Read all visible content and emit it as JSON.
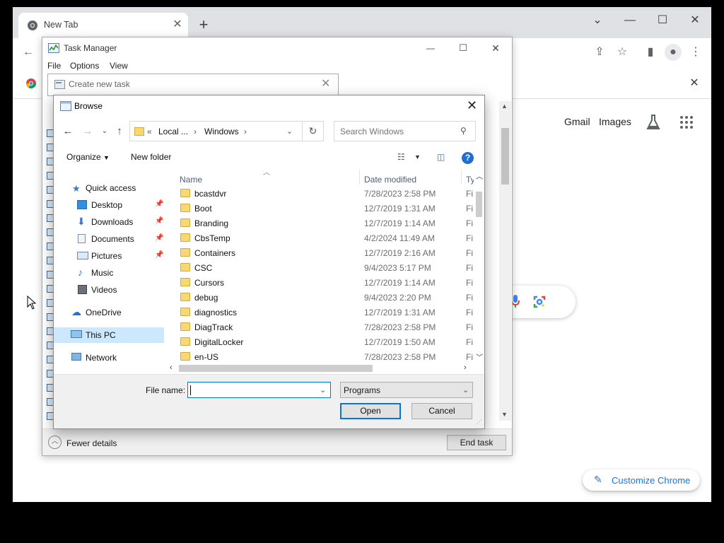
{
  "chrome": {
    "tab_title": "New Tab",
    "new_tab": "+",
    "ntp_links": [
      "Gmail",
      "Images"
    ],
    "customize_label": "Customize Chrome"
  },
  "task_manager": {
    "title": "Task Manager",
    "menu": [
      "File",
      "Options",
      "View"
    ],
    "fewer_details": "Fewer details",
    "end_task": "End task"
  },
  "create_task": {
    "title": "Create new task"
  },
  "browse": {
    "title": "Browse",
    "breadcrumb": {
      "overflow": "«",
      "segments": [
        "Local ...",
        "Windows"
      ]
    },
    "search_placeholder": "Search Windows",
    "organize": "Organize",
    "new_folder": "New folder",
    "columns": {
      "name": "Name",
      "date": "Date modified",
      "type": "Ty"
    },
    "nav": [
      {
        "label": "Quick access",
        "icon": "star-icon"
      },
      {
        "label": "Desktop",
        "icon": "desktop-icon",
        "pinned": true
      },
      {
        "label": "Downloads",
        "icon": "download-icon",
        "pinned": true
      },
      {
        "label": "Documents",
        "icon": "documents-icon",
        "pinned": true
      },
      {
        "label": "Pictures",
        "icon": "pictures-icon",
        "pinned": true
      },
      {
        "label": "Music",
        "icon": "music-icon"
      },
      {
        "label": "Videos",
        "icon": "videos-icon"
      },
      {
        "label": "OneDrive",
        "icon": "cloud-icon"
      },
      {
        "label": "This PC",
        "icon": "computer-icon",
        "selected": true
      },
      {
        "label": "Network",
        "icon": "network-icon"
      }
    ],
    "files": [
      {
        "name": "bcastdvr",
        "date": "7/28/2023 2:58 PM",
        "type": "Fi"
      },
      {
        "name": "Boot",
        "date": "12/7/2019 1:31 AM",
        "type": "Fi"
      },
      {
        "name": "Branding",
        "date": "12/7/2019 1:14 AM",
        "type": "Fi"
      },
      {
        "name": "CbsTemp",
        "date": "4/2/2024 11:49 AM",
        "type": "Fi"
      },
      {
        "name": "Containers",
        "date": "12/7/2019 2:16 AM",
        "type": "Fi"
      },
      {
        "name": "CSC",
        "date": "9/4/2023 5:17 PM",
        "type": "Fi"
      },
      {
        "name": "Cursors",
        "date": "12/7/2019 1:14 AM",
        "type": "Fi"
      },
      {
        "name": "debug",
        "date": "9/4/2023 2:20 PM",
        "type": "Fi"
      },
      {
        "name": "diagnostics",
        "date": "12/7/2019 1:31 AM",
        "type": "Fi"
      },
      {
        "name": "DiagTrack",
        "date": "7/28/2023 2:58 PM",
        "type": "Fi"
      },
      {
        "name": "DigitalLocker",
        "date": "12/7/2019 1:50 AM",
        "type": "Fi"
      },
      {
        "name": "en-US",
        "date": "7/28/2023 2:58 PM",
        "type": "Fi"
      }
    ],
    "file_name_label": "File name:",
    "file_name_value": "",
    "file_type": "Programs",
    "open": "Open",
    "cancel": "Cancel"
  },
  "colors": {
    "accent": "#0078d7",
    "folder": "#f8d775",
    "selected_nav": "#cce8ff",
    "chrome_link": "#1a73e8"
  }
}
